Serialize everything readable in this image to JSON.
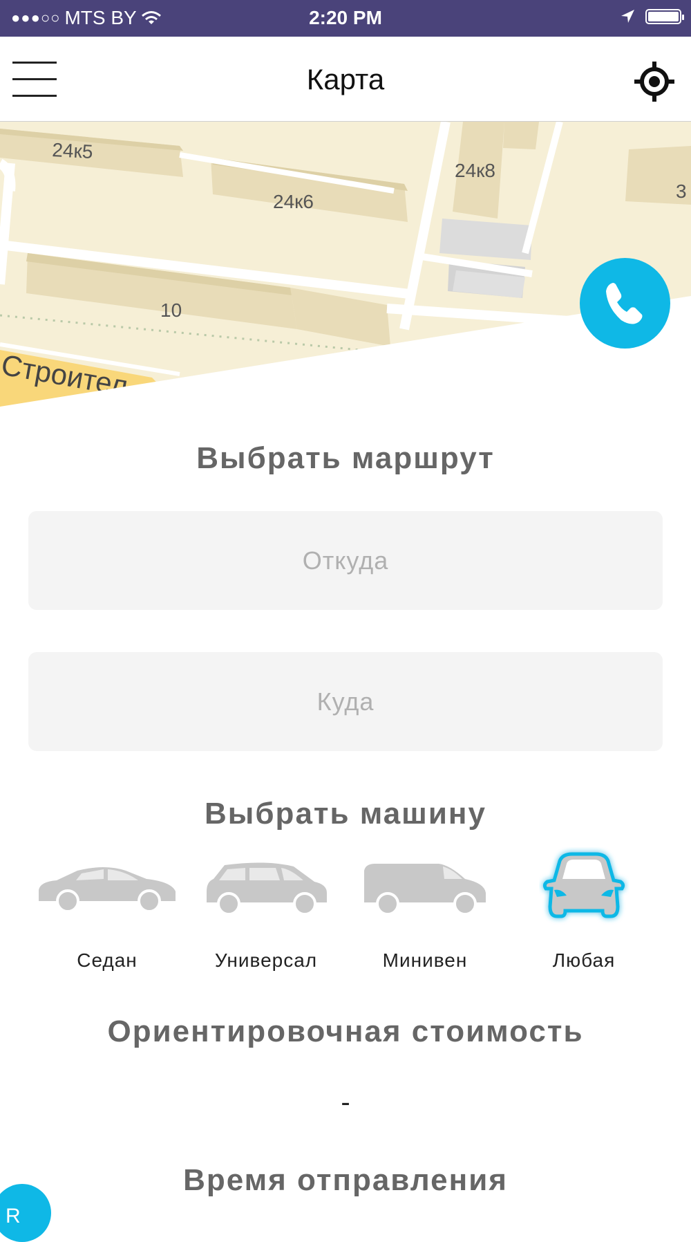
{
  "status_bar": {
    "signal": "●●●○○",
    "carrier": "MTS BY",
    "time": "2:20 PM"
  },
  "nav": {
    "title": "Карта",
    "menu_icon": "hamburger-menu-icon",
    "locate_icon": "crosshair-location-icon"
  },
  "map": {
    "labels": [
      "24к5",
      "24к6",
      "24к8",
      "10",
      "Строител",
      "3"
    ],
    "call_icon": "phone-icon"
  },
  "route": {
    "title": "Выбрать маршрут",
    "from_placeholder": "Откуда",
    "from_value": "",
    "to_placeholder": "Куда",
    "to_value": ""
  },
  "car_select": {
    "title": "Выбрать машину",
    "options": [
      {
        "label": "Седан",
        "icon": "sedan-car-icon",
        "selected": false
      },
      {
        "label": "Универсал",
        "icon": "wagon-car-icon",
        "selected": false
      },
      {
        "label": "Минивен",
        "icon": "minivan-icon",
        "selected": false
      },
      {
        "label": "Любая",
        "icon": "any-car-front-icon",
        "selected": true
      }
    ],
    "selected_color": "#0fb8e6",
    "unselected_color": "#c8c8c8"
  },
  "estimate": {
    "title": "Ориентировочная стоимость",
    "value": "-"
  },
  "departure": {
    "title": "Время отправления"
  },
  "floating_badge": {
    "label": "R"
  },
  "colors": {
    "status_bar": "#4a437a",
    "accent": "#0fb8e6",
    "map_bg": "#f6efd6",
    "input_bg": "#f4f4f4",
    "heading": "#666666"
  }
}
